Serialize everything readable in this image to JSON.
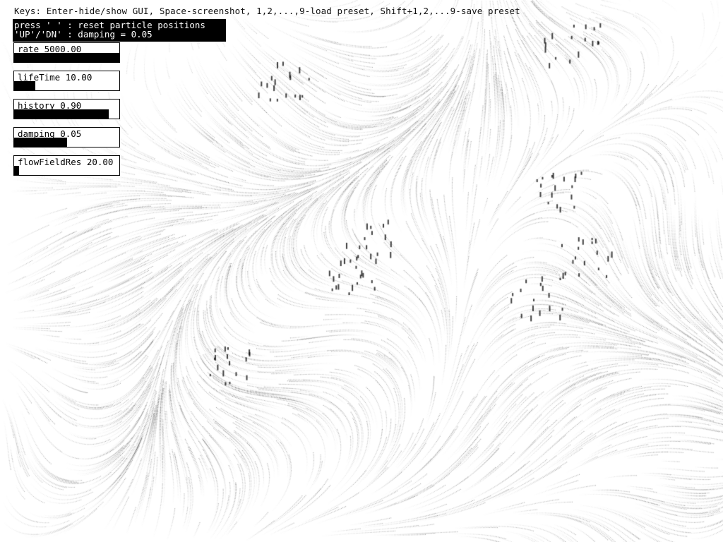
{
  "keys_help": "Keys: Enter-hide/show GUI, Space-screenshot, 1,2,...,9-load preset, Shift+1,2,...9-save preset",
  "info": {
    "line1": "press ' ' : reset particle positions",
    "line2": "'UP'/'DN' : damping = 0.05"
  },
  "sliders": [
    {
      "name": "rate",
      "label": "rate 5000.00",
      "fill": 1.0
    },
    {
      "name": "lifetime",
      "label": "lifeTime 10.00",
      "fill": 0.2
    },
    {
      "name": "history",
      "label": "history 0.90",
      "fill": 0.9
    },
    {
      "name": "damping",
      "label": "damping 0.05",
      "fill": 0.5
    },
    {
      "name": "flowfieldres",
      "label": "flowFieldRes 20.00",
      "fill": 0.05
    }
  ],
  "colors": {
    "background": "#ffffff",
    "particles": "#000000",
    "panel": "#000000",
    "panel_text": "#ffffff"
  }
}
